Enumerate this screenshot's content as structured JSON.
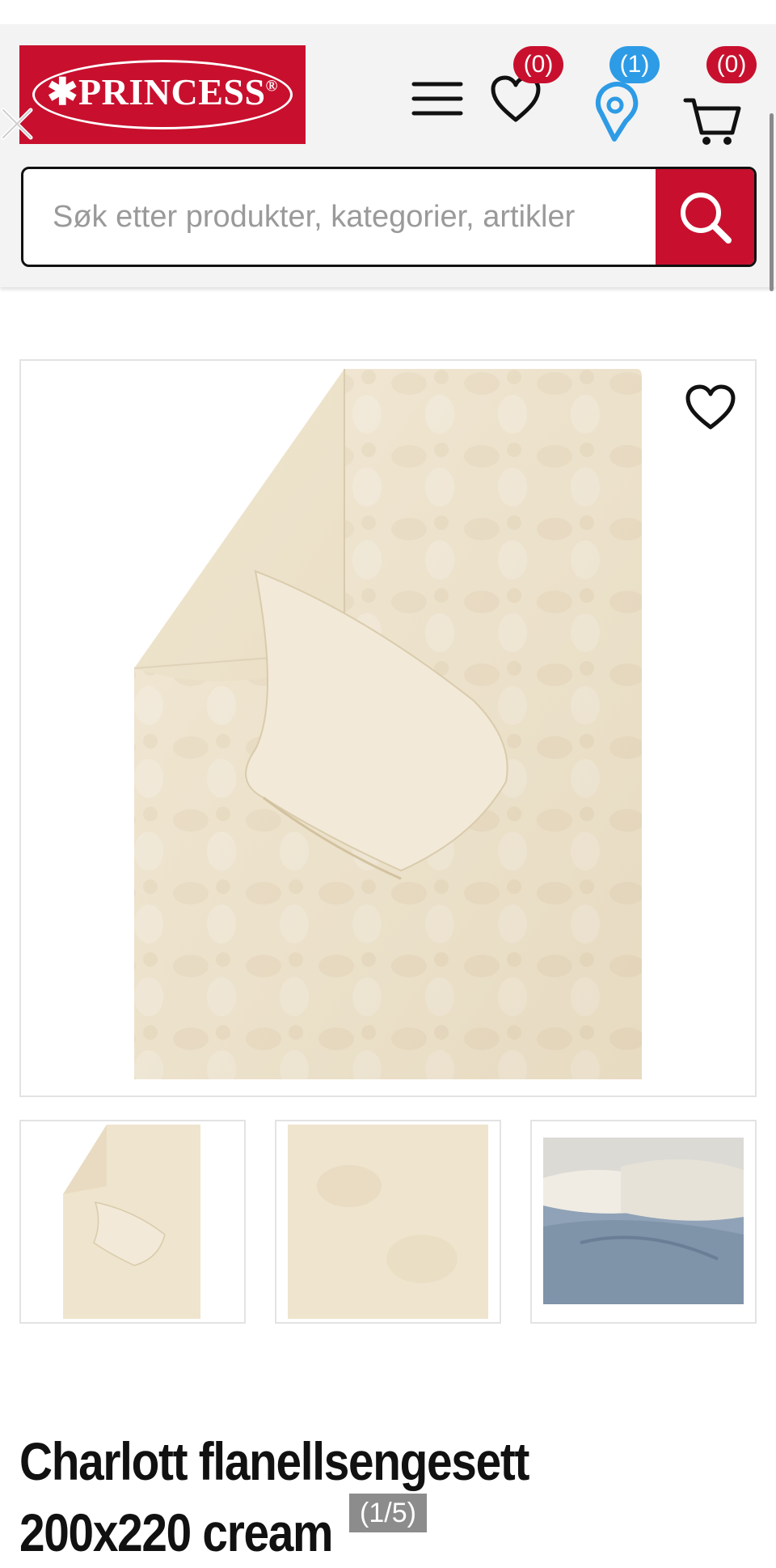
{
  "header": {
    "logo_text": "PRINCESS",
    "logo_mark": "®",
    "wishlist_count": "(0)",
    "stores_count": "(1)",
    "cart_count": "(0)"
  },
  "search": {
    "placeholder": "Søk etter produkter, kategorier, artikler"
  },
  "product": {
    "title": "Charlott flanellsengesett 200x220 cream",
    "image_counter": "(1/5)"
  },
  "icons": [
    "close-icon",
    "menu-icon",
    "heart-icon",
    "location-icon",
    "cart-icon",
    "search-icon"
  ],
  "colors": {
    "brand_red": "#c8102e",
    "badge_blue": "#2d9be6",
    "fabric_cream": "#efe3cb"
  }
}
